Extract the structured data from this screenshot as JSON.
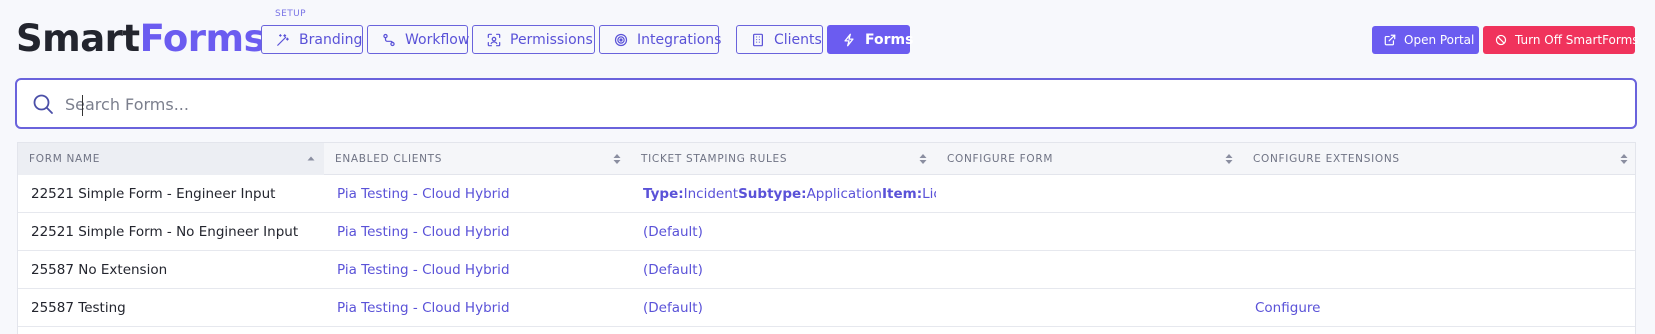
{
  "brand": {
    "part1": "Smart",
    "part2": "Forms",
    "accent": "#6b5cf0"
  },
  "setup_label": "SETUP",
  "nav": [
    {
      "label": "Branding",
      "icon": "magic-wand-icon"
    },
    {
      "label": "Workflow",
      "icon": "route-icon"
    },
    {
      "label": "Permissions",
      "icon": "scan-face-icon"
    },
    {
      "label": "Integrations",
      "icon": "target-icon"
    },
    {
      "label": "Clients",
      "icon": "building-icon"
    },
    {
      "label": "Forms",
      "icon": "lightning-icon",
      "active": true
    }
  ],
  "actions": {
    "open_portal": {
      "label": "Open Portal",
      "icon": "external-link-icon",
      "color": "#6b5cf0"
    },
    "turn_off": {
      "label": "Turn Off SmartForms",
      "icon": "ban-icon",
      "color": "#f0335c"
    }
  },
  "search": {
    "placeholder": "Search Forms...",
    "value": ""
  },
  "table": {
    "columns": [
      "FORM NAME",
      "ENABLED CLIENTS",
      "TICKET STAMPING RULES",
      "CONFIGURE FORM",
      "CONFIGURE EXTENSIONS"
    ],
    "rows": [
      {
        "name": "22521 Simple Form - Engineer Input",
        "client": "Pia Testing - Cloud Hybrid",
        "rules": {
          "type_label": "Type:",
          "type": "Incident",
          "subtype_label": "Subtype:",
          "subtype": "Application",
          "item_label": "Item:",
          "item": "Lice"
        },
        "configure_form": "",
        "configure_ext": ""
      },
      {
        "name": "22521 Simple Form - No Engineer Input",
        "client": "Pia Testing - Cloud Hybrid",
        "rules_text": "(Default)",
        "configure_form": "",
        "configure_ext": ""
      },
      {
        "name": "25587 No Extension",
        "client": "Pia Testing - Cloud Hybrid",
        "rules_text": "(Default)",
        "configure_form": "",
        "configure_ext": ""
      },
      {
        "name": "25587 Testing",
        "client": "Pia Testing - Cloud Hybrid",
        "rules_text": "(Default)",
        "configure_form": "",
        "configure_ext": "Configure"
      }
    ]
  }
}
